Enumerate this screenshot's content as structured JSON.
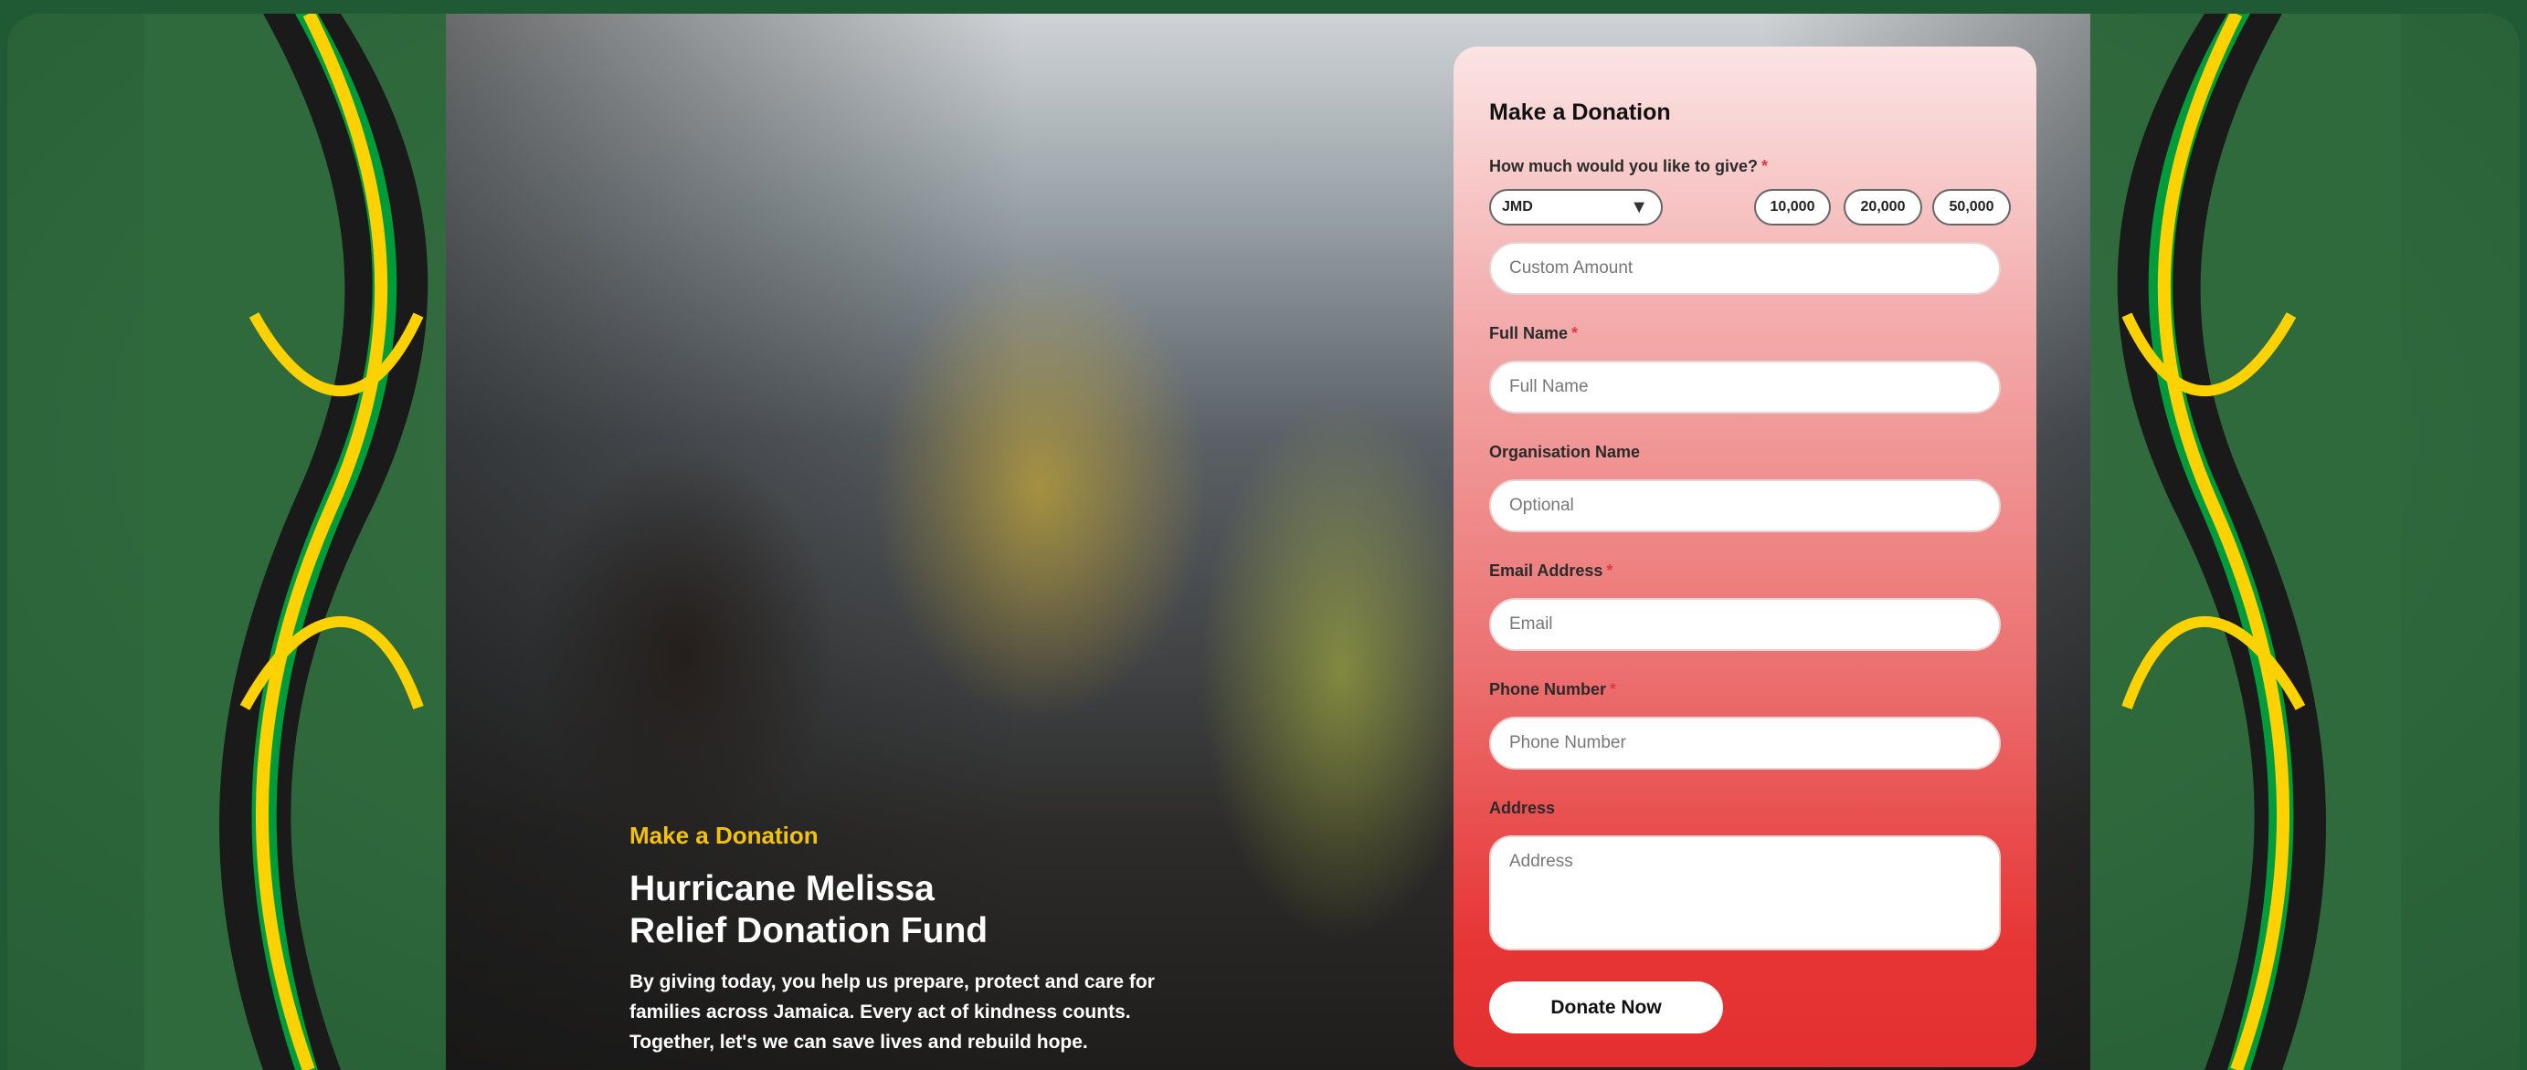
{
  "hero": {
    "eyebrow": "Make a Donation",
    "headline_line1": "Hurricane Melissa",
    "headline_line2": "Relief Donation Fund",
    "body": "By giving today, you help us prepare, protect and care for families across Jamaica. Every act of kindness counts. Together, let's we can save lives and rebuild hope."
  },
  "form": {
    "title": "Make a Donation",
    "amount_label": "How much would you like to give?",
    "required_mark": "*",
    "currency": "JMD",
    "presets": [
      "10,000",
      "20,000",
      "50,000"
    ],
    "custom_amount_placeholder": "Custom Amount",
    "full_name_label": "Full Name",
    "full_name_placeholder": "Full Name",
    "org_label": "Organisation Name",
    "org_placeholder": "Optional",
    "email_label": "Email Address",
    "email_placeholder": "Email",
    "phone_label": "Phone Number",
    "phone_placeholder": "Phone Number",
    "address_label": "Address",
    "address_placeholder": "Address",
    "submit_label": "Donate Now"
  },
  "colors": {
    "flag_green": "#009b3a",
    "flag_gold": "#fed100",
    "flag_black": "#1a1a1a",
    "accent_yellow": "#f4c20d",
    "required_red": "#e23b3b",
    "card_red": "#e32f2f"
  }
}
